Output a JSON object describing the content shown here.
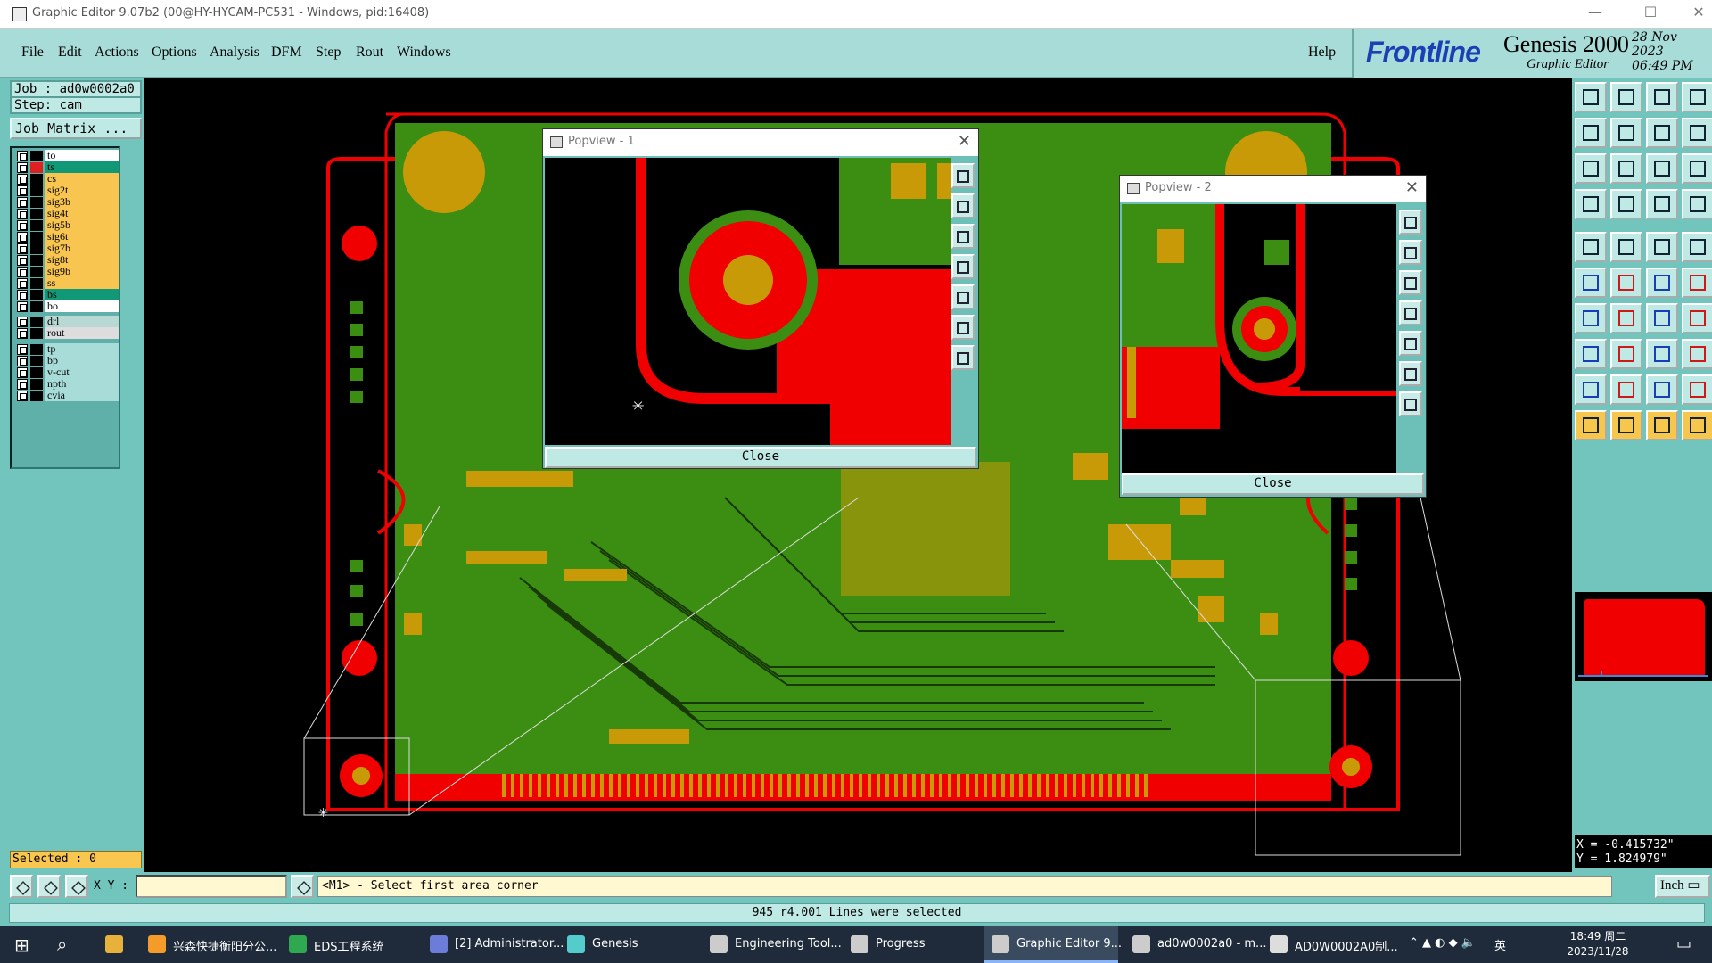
{
  "window": {
    "title": "Graphic Editor 9.07b2 (00@HY-HYCAM-PC531 - Windows, pid:16408)",
    "minimize": "—",
    "maximize": "☐",
    "close": "✕"
  },
  "menu": {
    "items": [
      "File",
      "Edit",
      "Actions",
      "Options",
      "Analysis",
      "DFM",
      "Step",
      "Rout",
      "Windows"
    ],
    "help": "Help"
  },
  "brand": {
    "logo": "Frontline",
    "product": "Genesis 2000",
    "subtitle": "Graphic Editor",
    "date": "28 Nov 2023",
    "time": "06:49 PM"
  },
  "job": {
    "job_label": "Job : ad0w0002a0",
    "step_label": "Step: cam",
    "job_matrix": "Job Matrix ..."
  },
  "layers": [
    {
      "name": "to",
      "color": "#ffffff",
      "box": "#000000"
    },
    {
      "name": "ts",
      "color": "#119977",
      "box": "#e02020"
    },
    {
      "name": "cs",
      "color": "#f8c550",
      "box": "#000000"
    },
    {
      "name": "sig2t",
      "color": "#f8c550",
      "box": "#000000"
    },
    {
      "name": "sig3b",
      "color": "#f8c550",
      "box": "#000000"
    },
    {
      "name": "sig4t",
      "color": "#f8c550",
      "box": "#000000"
    },
    {
      "name": "sig5b",
      "color": "#f8c550",
      "box": "#000000"
    },
    {
      "name": "sig6t",
      "color": "#f8c550",
      "box": "#000000"
    },
    {
      "name": "sig7b",
      "color": "#f8c550",
      "box": "#000000"
    },
    {
      "name": "sig8t",
      "color": "#f8c550",
      "box": "#000000"
    },
    {
      "name": "sig9b",
      "color": "#f8c550",
      "box": "#000000"
    },
    {
      "name": "ss",
      "color": "#f8c550",
      "box": "#000000"
    },
    {
      "name": "bs",
      "color": "#119977",
      "box": "#000000"
    },
    {
      "name": "bo",
      "color": "#ffffff",
      "box": "#000000"
    },
    {
      "name": "drl",
      "color": "#b8d8d4",
      "box": "#000000"
    },
    {
      "name": "rout",
      "color": "#dddddd",
      "box": "#000000"
    },
    {
      "name": "tp",
      "color": "#a8dcd8",
      "box": "#000000"
    },
    {
      "name": "bp",
      "color": "#a8dcd8",
      "box": "#000000"
    },
    {
      "name": "v-cut",
      "color": "#a8dcd8",
      "box": "#000000"
    },
    {
      "name": "npth",
      "color": "#a8dcd8",
      "box": "#000000"
    },
    {
      "name": "cvia",
      "color": "#a8dcd8",
      "box": "#000000"
    }
  ],
  "selected": "Selected : 0",
  "popup1": {
    "title": "Popview - 1",
    "close": "Close"
  },
  "popup2": {
    "title": "Popview - 2",
    "close": "Close"
  },
  "coords": {
    "x": "X = -0.415732\"",
    "y": "Y = 1.824979\""
  },
  "command": {
    "xy_label": "X Y :",
    "xy_value": "",
    "prompt": "<M1> - Select first area corner",
    "unit": "Inch"
  },
  "status": "945 r4.001 Lines were selected",
  "colors": {
    "board": "#3b8e12",
    "copper": "#c99a08",
    "red": "#f00000",
    "panel": "#72c5bd",
    "light": "#bfe9e4"
  },
  "taskbar": {
    "items": [
      "兴森快捷衡阳分公...",
      "EDS工程系统",
      "[2] Administrator...",
      "Genesis",
      "Engineering Tool...",
      "Progress",
      "Graphic Editor 9...",
      "ad0w0002a0 - m...",
      "AD0W0002A0制..."
    ],
    "time": "18:49 周二",
    "date": "2023/11/28",
    "ime": "英"
  }
}
